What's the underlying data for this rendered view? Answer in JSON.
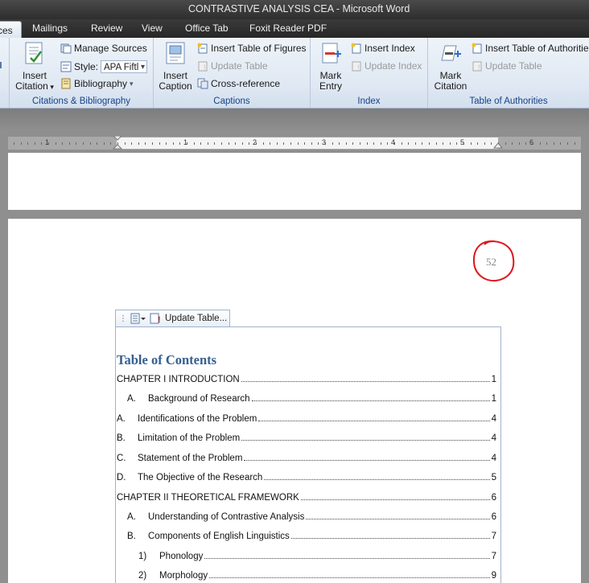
{
  "window": {
    "title": "CONTRASTIVE ANALYSIS CEA  -  Microsoft Word"
  },
  "tabs": [
    {
      "label": "ces",
      "active": true
    },
    {
      "label": "Mailings"
    },
    {
      "label": "Review"
    },
    {
      "label": "View"
    },
    {
      "label": "Office Tab"
    },
    {
      "label": "Foxit Reader PDF"
    }
  ],
  "ribbon": {
    "citations": {
      "insert_citation_line1": "Insert",
      "insert_citation_line2": "Citation",
      "manage_sources": "Manage Sources",
      "style_label": "Style:",
      "style_value": "APA Fiftl",
      "bibliography": "Bibliography",
      "group_label": "Citations & Bibliography"
    },
    "captions": {
      "insert_caption_line1": "Insert",
      "insert_caption_line2": "Caption",
      "insert_table_of_figures": "Insert Table of Figures",
      "update_table": "Update Table",
      "cross_reference": "Cross-reference",
      "group_label": "Captions"
    },
    "index": {
      "mark_entry_line1": "Mark",
      "mark_entry_line2": "Entry",
      "insert_index": "Insert Index",
      "update_index": "Update Index",
      "group_label": "Index"
    },
    "toa": {
      "mark_citation_line1": "Mark",
      "mark_citation_line2": "Citation",
      "insert_toa": "Insert Table of Authoritie",
      "update_table": "Update Table",
      "group_label": "Table of Authorities"
    }
  },
  "ruler": {
    "numbers": [
      "1",
      "1",
      "2",
      "3",
      "4",
      "5",
      "6"
    ]
  },
  "page": {
    "number": "52"
  },
  "toc": {
    "control_button": "Update Table...",
    "title": "Table of Contents",
    "entries": [
      {
        "prefix": "",
        "label": "CHAPTER I INTRODUCTION",
        "page": "1"
      },
      {
        "prefix": "A.",
        "label": "Background of Research",
        "page": "1"
      },
      {
        "prefix": "A.",
        "label": "Identifications of the Problem",
        "page": "4"
      },
      {
        "prefix": "B.",
        "label": "Limitation of the Problem",
        "page": "4"
      },
      {
        "prefix": "C.",
        "label": "Statement of the Problem",
        "page": "4"
      },
      {
        "prefix": "D.",
        "label": "The Objective of the Research",
        "page": "5"
      },
      {
        "prefix": "",
        "label": "CHAPTER II THEORETICAL FRAMEWORK",
        "page": "6"
      },
      {
        "prefix": "A.",
        "label": "Understanding of Contrastive Analysis",
        "page": "6"
      },
      {
        "prefix": "B.",
        "label": "Components of English Linguistics",
        "page": "7"
      },
      {
        "prefix": "1)",
        "label": "Phonology",
        "page": "7"
      },
      {
        "prefix": "2)",
        "label": "Morphology",
        "page": "9"
      }
    ]
  }
}
